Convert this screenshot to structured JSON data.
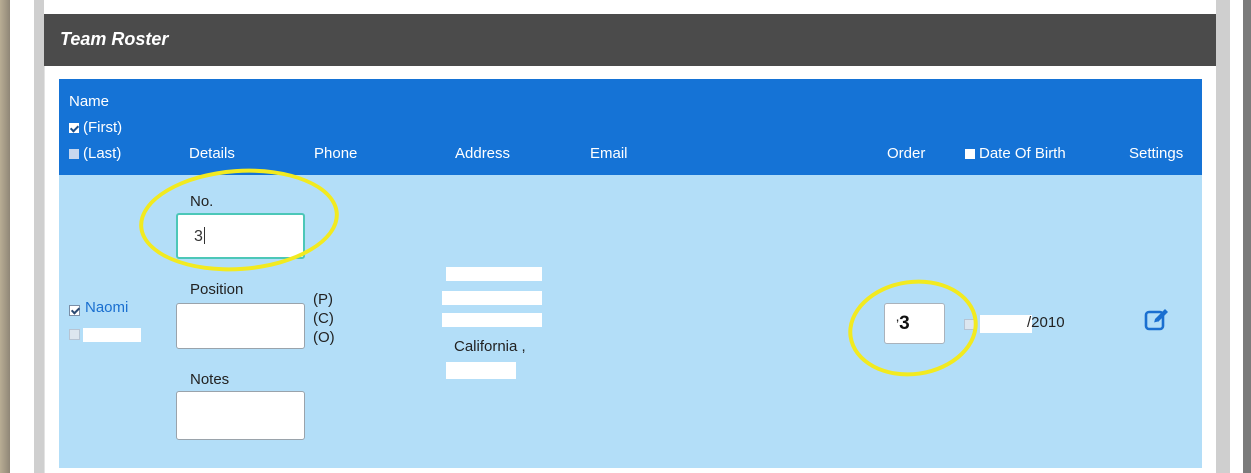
{
  "panel": {
    "title": "Team Roster"
  },
  "header": {
    "name_label": "Name",
    "first_label": "(First)",
    "last_label": "(Last)",
    "details": "Details",
    "phone": "Phone",
    "address": "Address",
    "email": "Email",
    "order": "Order",
    "dob": "Date Of Birth",
    "settings": "Settings"
  },
  "row": {
    "first_name": "Naomi",
    "no_label": "No.",
    "no_value": "3",
    "position_label": "Position",
    "position_options": [
      "(P)",
      "(C)",
      "(O)"
    ],
    "notes_label": "Notes",
    "address_state": "California ,",
    "order_value": "3",
    "order_prefix": "’",
    "dob_value": "/2010"
  },
  "colors": {
    "header_bg": "#1573d6",
    "row_bg": "#b3def8",
    "panel_head_bg": "#4b4b4b",
    "highlight": "#f2ea20",
    "link": "#1a6fd0"
  },
  "icons": {
    "settings_edit": "edit-icon"
  }
}
